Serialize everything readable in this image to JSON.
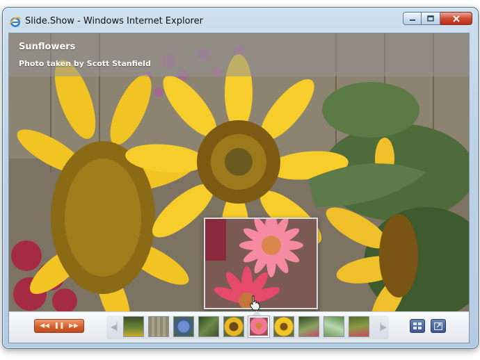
{
  "window": {
    "title": "Slide.Show - Windows Internet Explorer"
  },
  "slide": {
    "title": "Sunflowers",
    "credit": "Photo taken by Scott Stanfield"
  },
  "controls": {
    "transport": [
      "previous",
      "pause",
      "next"
    ],
    "thumbnail_count": 10,
    "selected_thumbnail": 6
  },
  "thumbnails": [
    {
      "name": "thumb-1",
      "color": "#5c6b2a"
    },
    {
      "name": "thumb-2",
      "color": "#8d8c73"
    },
    {
      "name": "thumb-3",
      "color": "#4d6fa0"
    },
    {
      "name": "thumb-4",
      "color": "#3f5a2c"
    },
    {
      "name": "thumb-5",
      "color": "#d6a325"
    },
    {
      "name": "thumb-6",
      "color": "#e0657e"
    },
    {
      "name": "thumb-7",
      "color": "#e5b323"
    },
    {
      "name": "thumb-8",
      "color": "#5e7a3a"
    },
    {
      "name": "thumb-9",
      "color": "#7fa36b"
    },
    {
      "name": "thumb-10",
      "color": "#6e7f3a"
    }
  ]
}
